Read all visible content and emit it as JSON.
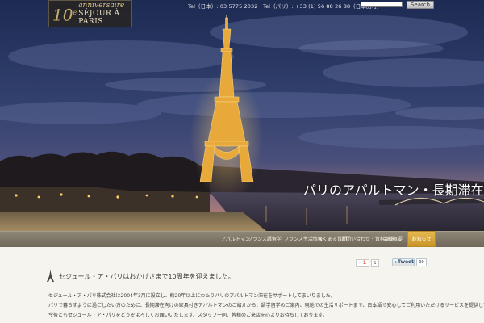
{
  "logo": {
    "number": "10",
    "superscript": "e",
    "anniversary": "anniversaire",
    "brand": "SÉJOUR À PARIS"
  },
  "header": {
    "tel_text": "Tel（日本）: 03 5775 2032　Tel（パリ）: +33 (1) 56 88 26 88（日本語可）",
    "search_placeholder": "",
    "search_label": "Search"
  },
  "hero": {
    "title": "パリのアパルトマン・長期滞在のセジュール・ア・パリ"
  },
  "nav": {
    "items": [
      {
        "label": "アパルトマン",
        "active": false
      },
      {
        "label": "フランス語留学",
        "active": false
      },
      {
        "label": "フランス生活情報",
        "active": false
      },
      {
        "label": "よくある質問",
        "active": false
      },
      {
        "label": "お問い合わせ・資料請求",
        "active": false
      },
      {
        "label": "会社概要",
        "active": false
      },
      {
        "label": "お知らせ",
        "active": true
      }
    ]
  },
  "social": {
    "gplus_label": "+1",
    "gplus_count": "1",
    "tweet_label": "Tweet",
    "tweet_count": "90"
  },
  "content": {
    "section_title": "セジュール・ア・パリはおかげさまで10周年を迎えました。",
    "paragraphs": [
      "セジュール・ア・パリ株式会社は2004年3月に設立し、約20年以上にわたりパリのアパルトマン滞在をサポートしてまいりました。",
      "パリで暮らすように過ごしたい方のために、長期滞在向けの家具付きアパルトマンのご紹介から、語学留学のご案内、現地での生活サポートまで、日本語で安心してご利用いただけるサービスを提供しております。これからも皆様のパリ生活のお手伝いをいたします。",
      "今後ともセジュール・ア・パリをどうぞよろしくお願いいたします。スタッフ一同、皆様のご来店を心よりお待ちしております。"
    ]
  }
}
